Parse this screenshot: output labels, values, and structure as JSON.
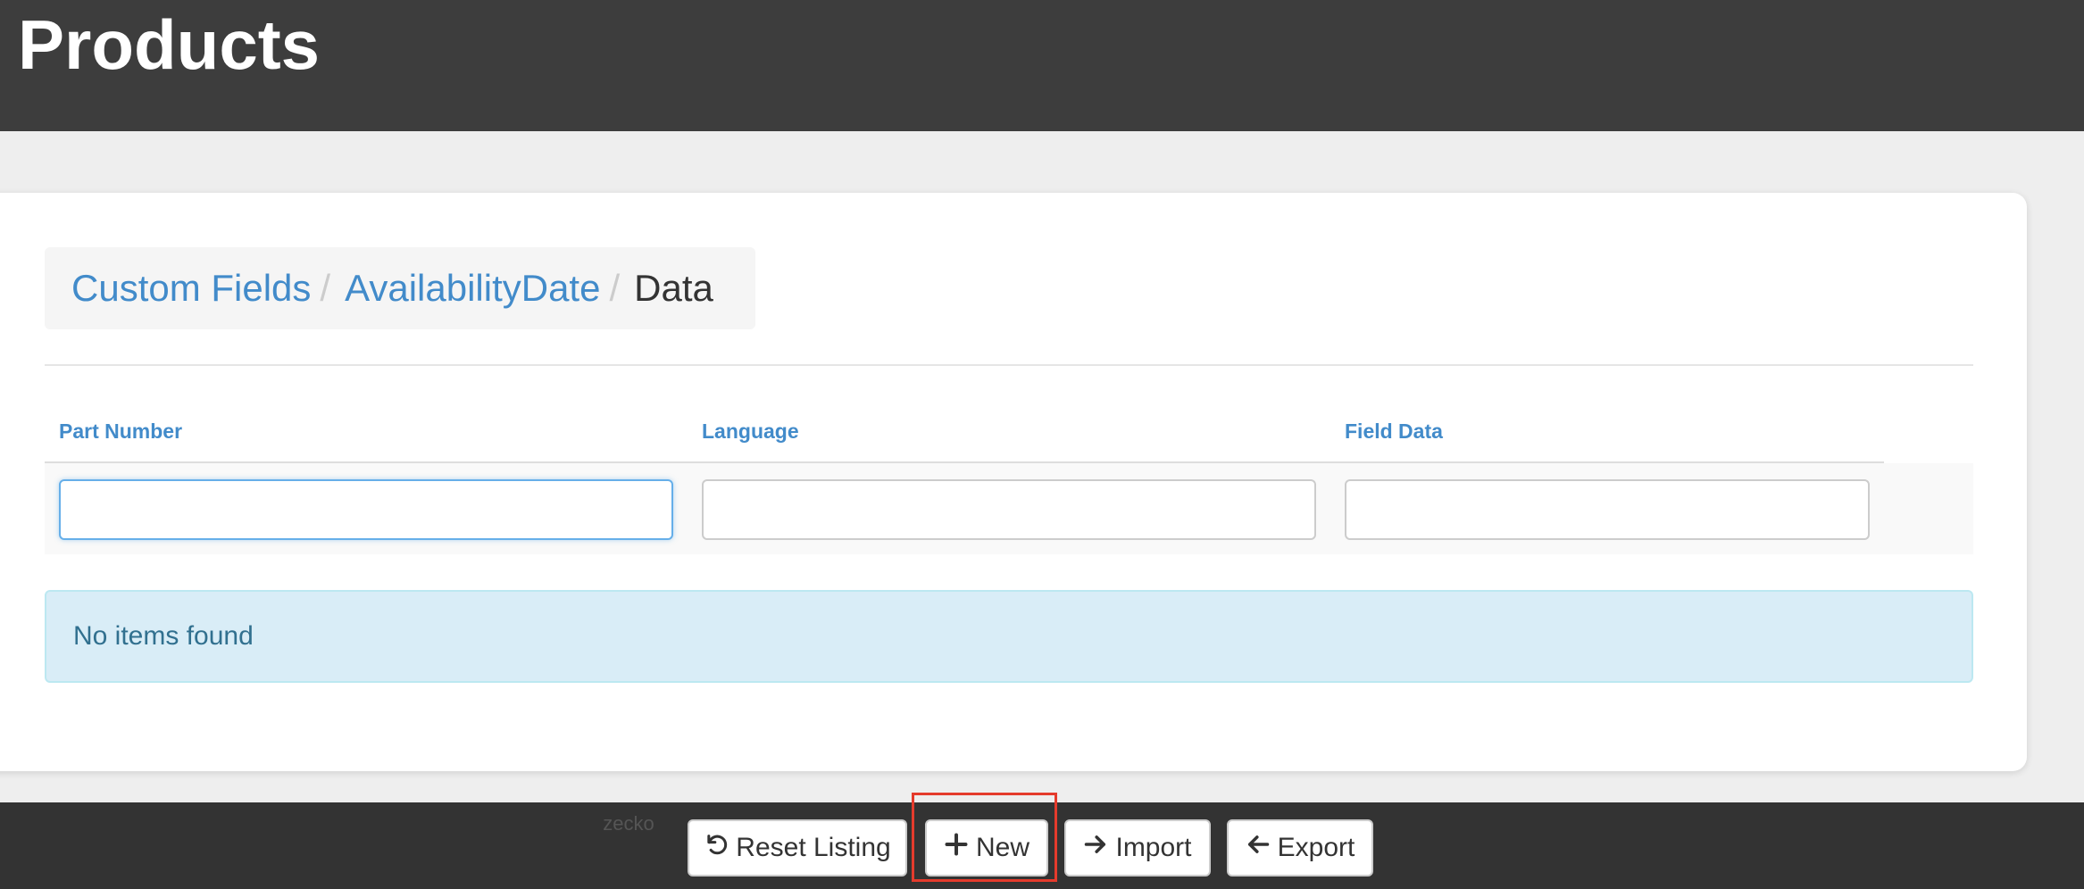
{
  "header": {
    "title": "Products"
  },
  "breadcrumb": {
    "items": [
      {
        "label": "Custom Fields"
      },
      {
        "label": "AvailabilityDate"
      }
    ],
    "separator": "/",
    "active": "Data"
  },
  "table": {
    "columns": [
      {
        "label": "Part Number"
      },
      {
        "label": "Language"
      },
      {
        "label": "Field Data"
      }
    ],
    "filters": [
      {
        "value": "",
        "placeholder": ""
      },
      {
        "value": "",
        "placeholder": ""
      },
      {
        "value": "",
        "placeholder": ""
      }
    ]
  },
  "alert": {
    "message": "No items found"
  },
  "footer": {
    "text": "zecko",
    "buttons": {
      "reset": {
        "label": "Reset Listing",
        "icon": "undo-icon"
      },
      "new": {
        "label": "New",
        "icon": "plus-icon"
      },
      "import": {
        "label": "Import",
        "icon": "arrow-right-icon"
      },
      "export": {
        "label": "Export",
        "icon": "arrow-left-icon"
      }
    }
  },
  "colors": {
    "link": "#428bca",
    "header_bg": "#3d3d3d",
    "alert_bg": "#d9edf7",
    "alert_text": "#31708f",
    "highlight": "#e53b2c"
  }
}
